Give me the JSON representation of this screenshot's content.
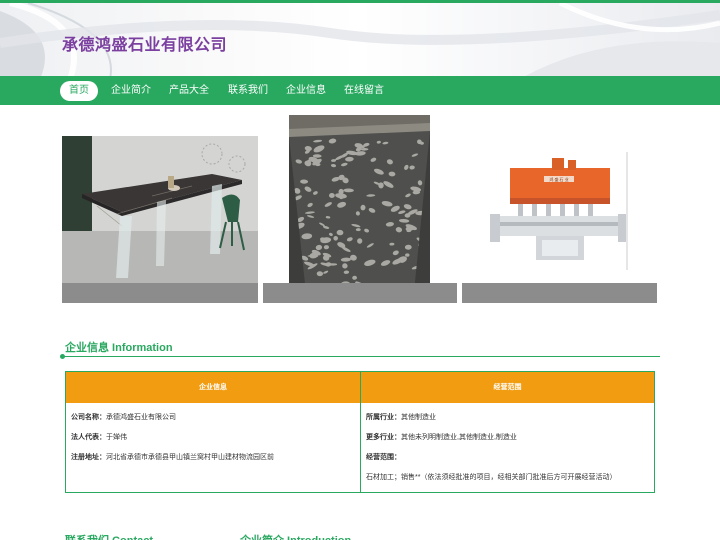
{
  "header": {
    "company_name": "承德鸿盛石业有限公司"
  },
  "nav": {
    "items": [
      {
        "label": "首页",
        "active": true
      },
      {
        "label": "企业简介",
        "active": false
      },
      {
        "label": "产品大全",
        "active": false
      },
      {
        "label": "联系我们",
        "active": false
      },
      {
        "label": "企业信息",
        "active": false
      },
      {
        "label": "在线留言",
        "active": false
      }
    ]
  },
  "gallery": {
    "items": [
      {
        "icon": "stone-table-photo"
      },
      {
        "icon": "carved-stone-slab-photo"
      },
      {
        "icon": "cnc-stone-machine-photo"
      }
    ],
    "machine_sign": "鸿 盛 石 业"
  },
  "info_section": {
    "title": "企业信息 Information",
    "left_header": "企业信息",
    "right_header": "经营范围",
    "left_rows": [
      {
        "key": "公司名称：",
        "value": "承德鸿盛石业有限公司"
      },
      {
        "key": "法人代表：",
        "value": "于婵伟"
      },
      {
        "key": "注册地址：",
        "value": "河北省承德市承德县甲山镇兰窝村甲山建材物流园区前"
      }
    ],
    "right_rows": [
      {
        "key": "所属行业：",
        "value": "其他制造业"
      },
      {
        "key": "更多行业：",
        "value": "其他未列明制造业,其他制造业,制造业"
      },
      {
        "key": "经营范围：",
        "value": "石材加工；销售**（依法须经批准的项目，经相关部门批准后方可开展经营活动）"
      }
    ]
  },
  "bottom": {
    "contact_title": "联系我们 Contact",
    "intro_title": "企业简介 Introduction"
  },
  "colors": {
    "brand_green": "#29a860",
    "logo_purple": "#7b3fa0",
    "table_header_orange": "#f29c11"
  }
}
